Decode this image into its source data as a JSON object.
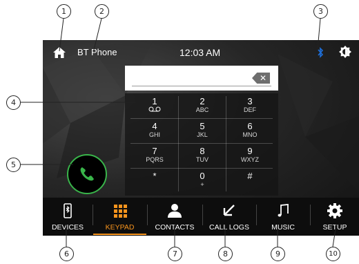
{
  "status_bar": {
    "source": "BT Phone",
    "time": "12:03 AM",
    "icons": [
      "home-icon",
      "bluetooth-icon",
      "brightness-icon"
    ],
    "bluetooth_color": "#1e6fd9"
  },
  "dialer": {
    "number": "",
    "backspace_icon": "backspace-icon"
  },
  "keypad": [
    {
      "digit": "1",
      "letters": "ⵙ",
      "voicemail": true
    },
    {
      "digit": "2",
      "letters": "ABC"
    },
    {
      "digit": "3",
      "letters": "DEF"
    },
    {
      "digit": "4",
      "letters": "GHI"
    },
    {
      "digit": "5",
      "letters": "JKL"
    },
    {
      "digit": "6",
      "letters": "MNO"
    },
    {
      "digit": "7",
      "letters": "PQRS"
    },
    {
      "digit": "8",
      "letters": "TUV"
    },
    {
      "digit": "9",
      "letters": "WXYZ"
    },
    {
      "digit": "*",
      "letters": ""
    },
    {
      "digit": "0",
      "letters": "+"
    },
    {
      "digit": "#",
      "letters": ""
    }
  ],
  "call": {
    "icon": "phone-icon",
    "color": "#39b54a"
  },
  "tabs": [
    {
      "label": "DEVICES",
      "icon": "bluetooth-phone-icon",
      "active": false
    },
    {
      "label": "KEYPAD",
      "icon": "keypad-grid-icon",
      "active": true
    },
    {
      "label": "CONTACTS",
      "icon": "person-icon",
      "active": false
    },
    {
      "label": "CALL LOGS",
      "icon": "call-log-arrow-icon",
      "active": false
    },
    {
      "label": "MUSIC",
      "icon": "music-note-icon",
      "active": false
    },
    {
      "label": "SETUP",
      "icon": "gear-icon",
      "active": false
    }
  ],
  "accent_color": "#f7941d",
  "callouts": [
    "1",
    "2",
    "3",
    "4",
    "5",
    "6",
    "7",
    "8",
    "9",
    "10"
  ]
}
